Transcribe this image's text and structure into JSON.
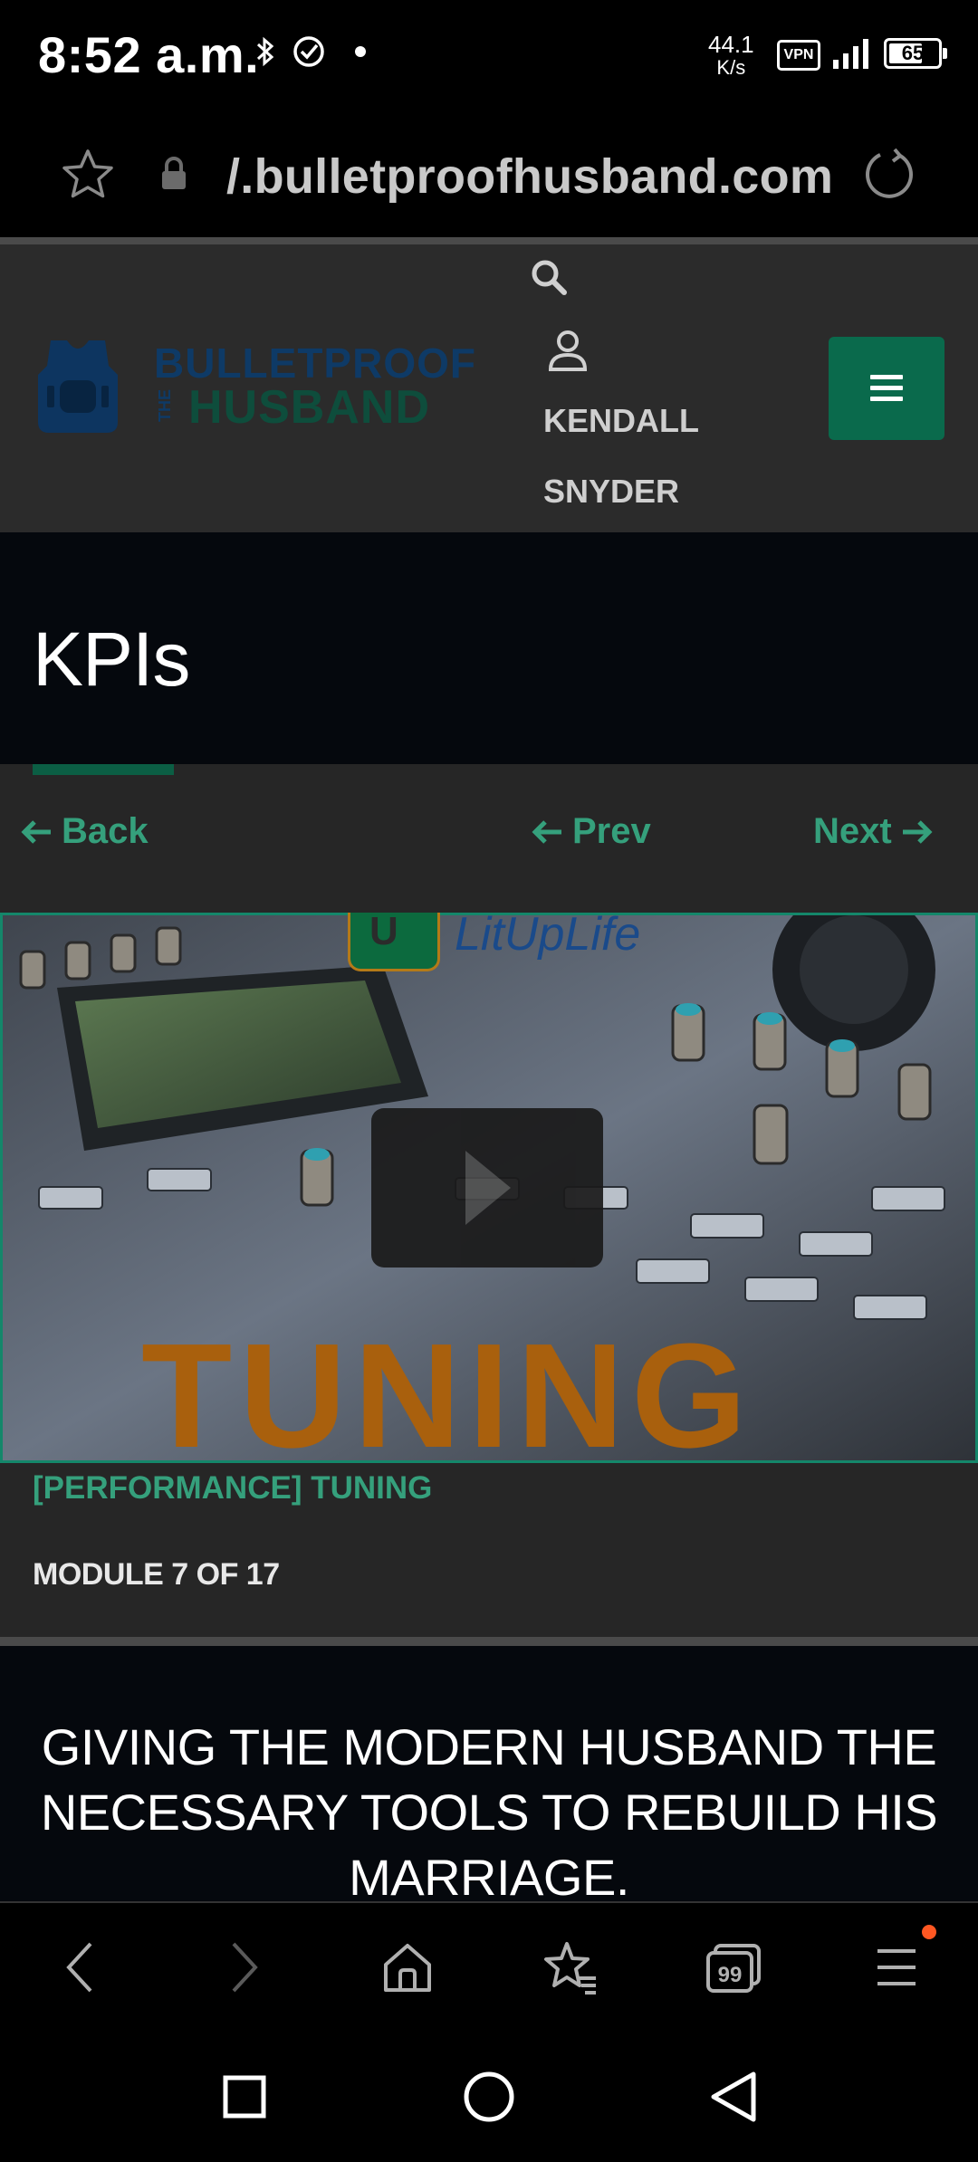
{
  "status_bar": {
    "time": "8:52 a.m.",
    "net_speed_value": "44.1",
    "net_speed_unit": "K/s",
    "vpn_label": "VPN",
    "battery_level": "65"
  },
  "browser": {
    "url": "/.bulletproofhusband.com"
  },
  "site_header": {
    "logo_line1": "BULLETPROOF",
    "logo_the": "THE",
    "logo_line2": "HUSBAND",
    "user_first": "KENDALL",
    "user_last": "SNYDER"
  },
  "page": {
    "title": "KPIs"
  },
  "lesson_nav": {
    "back": "Back",
    "prev": "Prev",
    "next": "Next"
  },
  "video": {
    "overlay_word": "TUNING",
    "brand": "LitUpLife",
    "brand_badge": "U"
  },
  "lesson": {
    "title": "[PERFORMANCE] TUNING",
    "module": "MODULE 7 OF 17"
  },
  "tagline": "GIVING THE MODERN HUSBAND THE NECESSARY TOOLS TO REBUILD HIS MARRIAGE.",
  "colors": {
    "accent_green": "#35a07c",
    "menu_button": "#0a6a4c",
    "notification_dot": "#ff5722"
  }
}
